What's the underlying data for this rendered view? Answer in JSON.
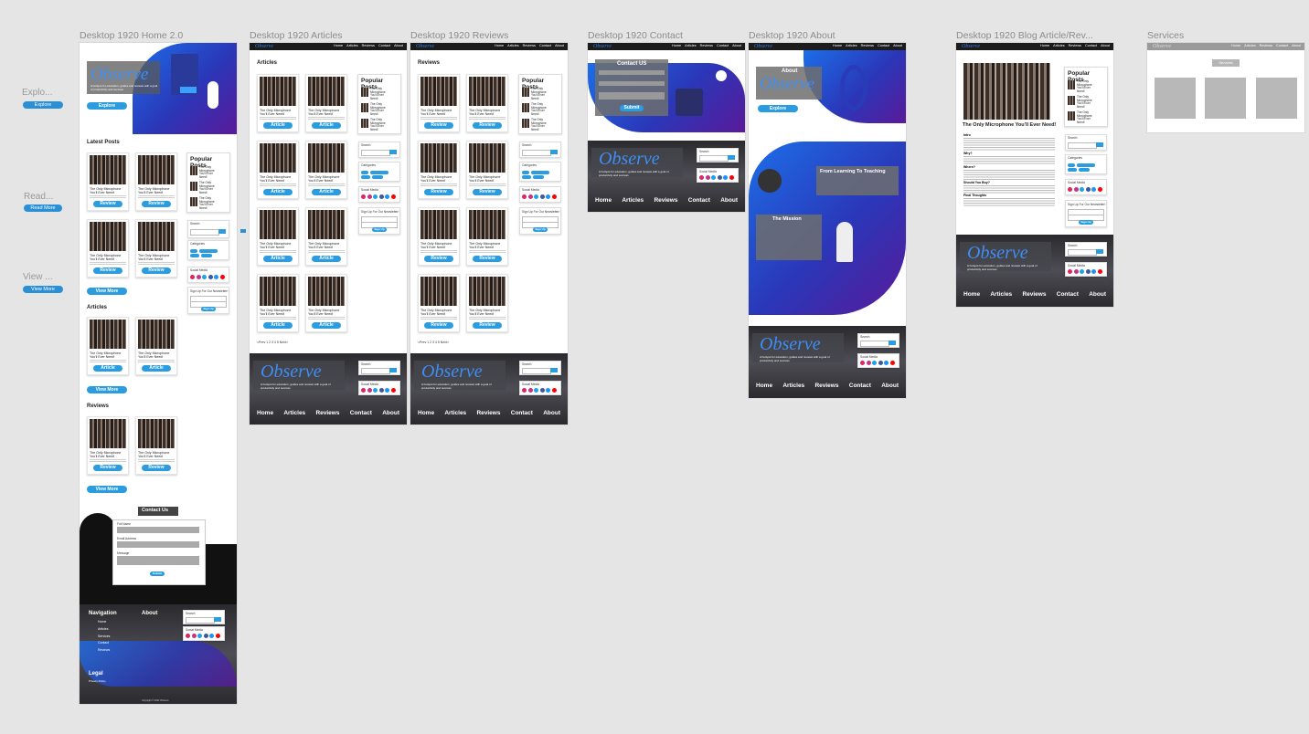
{
  "frames": {
    "home": "Desktop 1920 Home 2.0",
    "articles": "Desktop 1920 Articles",
    "reviews": "Desktop 1920 Reviews",
    "contact": "Desktop 1920 Contact",
    "about": "Desktop 1920 About",
    "blog": "Desktop 1920 Blog Article/Rev...",
    "services": "Services"
  },
  "side": {
    "explore_label": "Explo...",
    "explore_btn": "Explore",
    "read_label": "Read...",
    "read_btn": "Read More",
    "view_label": "View ...",
    "view_btn": "View More"
  },
  "brand": {
    "logo": "Observe",
    "tagline": "A hotspot for education, guides and reviews with a goal of productivity and success"
  },
  "nav": [
    "Home",
    "Articles",
    "Reviews",
    "Contact",
    "About"
  ],
  "home": {
    "explore": "Explore",
    "latest": "Latest Posts",
    "articles": "Articles",
    "reviews": "Reviews",
    "view_more": "View More",
    "contact_us": "Contact Us",
    "submit": "Submit",
    "full_name": "Full Name",
    "email": "Email Address",
    "message": "Message",
    "navigation": "Navigation",
    "about": "About",
    "legal": "Legal",
    "privacy": "Privacy Policy",
    "nav_links": [
      "Home",
      "Articles",
      "Services",
      "Contact",
      "Reviews"
    ]
  },
  "post_title": "The Only Microphone You'll Ever Need!",
  "buttons": {
    "review": "Review",
    "article": "Article"
  },
  "sidebar": {
    "popular": "Popular Posts",
    "search": "Search",
    "categories": "Categories",
    "social": "Social Media",
    "newsletter": "Sign Up For Our Newsletter!",
    "signup": "Sign Up"
  },
  "articles_page": {
    "heading": "Articles",
    "pager": "<Prev 1 2 3 4 5 Next>"
  },
  "reviews_page": {
    "heading": "Reviews",
    "pager": "<Prev 1 2 3 4 5 Next>"
  },
  "contact": {
    "heading": "Contact US",
    "submit": "Submit"
  },
  "about": {
    "heading": "About",
    "explore": "Explore",
    "learning": "From Learning To Teaching",
    "mission": "The Mission"
  },
  "blog": {
    "title": "The Only Microphone You'll Ever Need!",
    "intro": "Intro",
    "why": "Why?",
    "where": "Where?",
    "should": "Should You Buy?",
    "final": "Final Thoughts"
  },
  "services": {
    "button": "Services"
  },
  "copyright": "Copyright © 2021 Observe",
  "social_colors": [
    "#e0245e",
    "#c13584",
    "#1da1f2",
    "#3b5998",
    "#1e90ff",
    "#ff0000"
  ],
  "accent": "#2b9ce0"
}
